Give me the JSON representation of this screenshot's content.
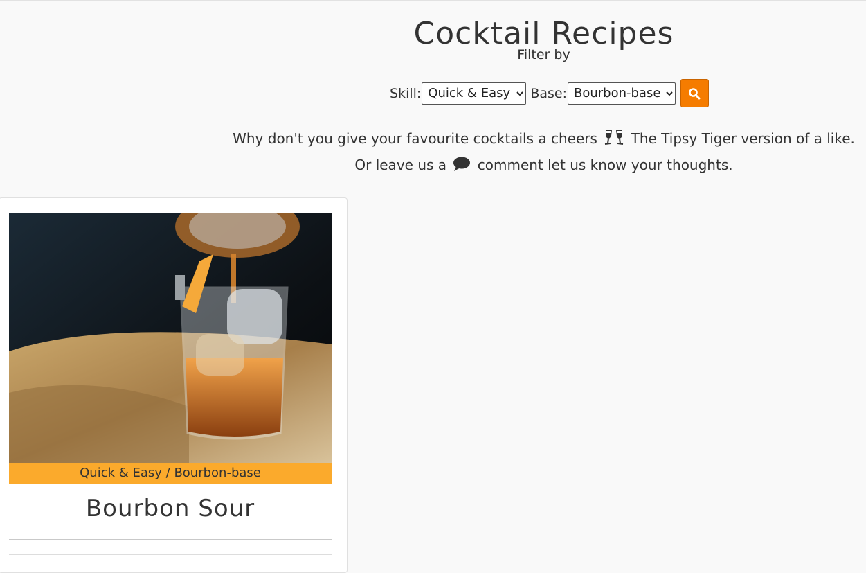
{
  "header": {
    "title": "Cocktail Recipes",
    "filter_label": "Filter by"
  },
  "filters": {
    "skill_label": "Skill:",
    "skill_selected": "Quick & Easy",
    "base_label": "Base:",
    "base_selected": "Bourbon-base",
    "search_icon": "search-icon"
  },
  "intro": {
    "line1_before": "Why don't you give your favourite cocktails a cheers",
    "line1_icon": "cheers-icon",
    "line1_after": "The Tipsy Tiger version of a like.",
    "line2_before": "Or leave us a",
    "line2_icon": "comment-icon",
    "line2_after": "comment let us know your thoughts."
  },
  "cards": [
    {
      "tag": "Quick & Easy / Bourbon-base",
      "title": "Bourbon Sour",
      "image": "cocktail-photo"
    }
  ],
  "colors": {
    "accent_button": "#f57c00",
    "tag_background": "#fbaa2c",
    "page_background": "#f9f9f9"
  }
}
